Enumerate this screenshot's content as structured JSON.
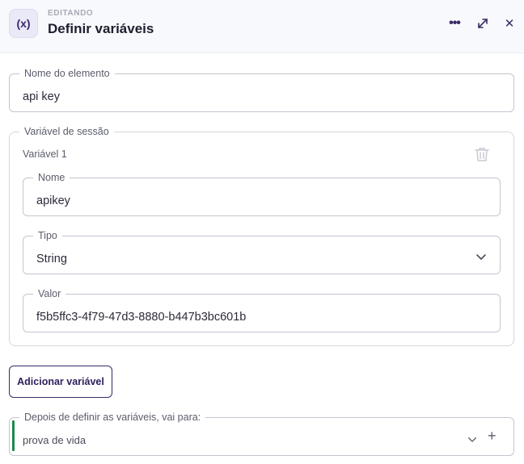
{
  "header": {
    "icon_glyph": "(x)",
    "icon_name": "variable-icon",
    "eyebrow": "EDITANDO",
    "title": "Definir variáveis",
    "more_glyph": "•••",
    "close_glyph": "✕"
  },
  "element_name": {
    "label": "Nome do elemento",
    "value": "api key"
  },
  "session_variables": {
    "label": "Variável de sessão",
    "items": [
      {
        "title": "Variável 1",
        "name_label": "Nome",
        "name_value": "apikey",
        "type_label": "Tipo",
        "type_value": "String",
        "value_label": "Valor",
        "value_value": "f5b5ffc3-4f79-47d3-8880-b447b3bc601b"
      }
    ]
  },
  "add_button": {
    "label": "Adicionar variável"
  },
  "next_step": {
    "label": "Depois de definir as variáveis, vai para:",
    "value": "prova de vida",
    "accent_color": "#1a8a4a",
    "plus_glyph": "+"
  },
  "colors": {
    "brand": "#3a2a6a",
    "border": "#c4c6d0"
  }
}
